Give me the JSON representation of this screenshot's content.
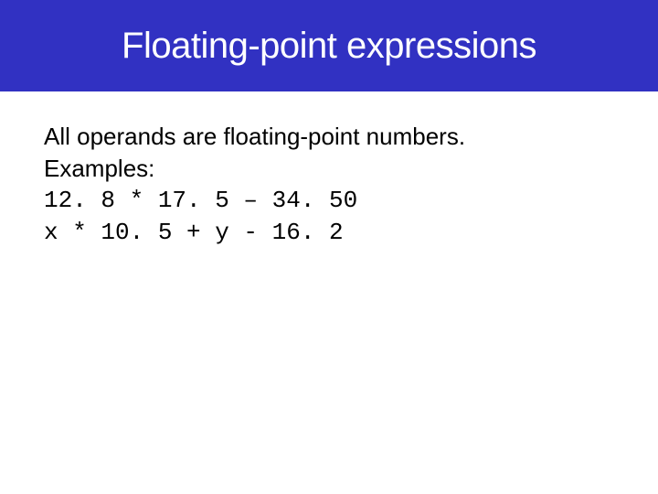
{
  "header": {
    "title": "Floating-point expressions"
  },
  "content": {
    "line1": "All operands are floating-point numbers.",
    "line2": "Examples:",
    "code1": "12. 8 * 17. 5 – 34. 50",
    "code2": "x * 10. 5 + y - 16. 2"
  }
}
